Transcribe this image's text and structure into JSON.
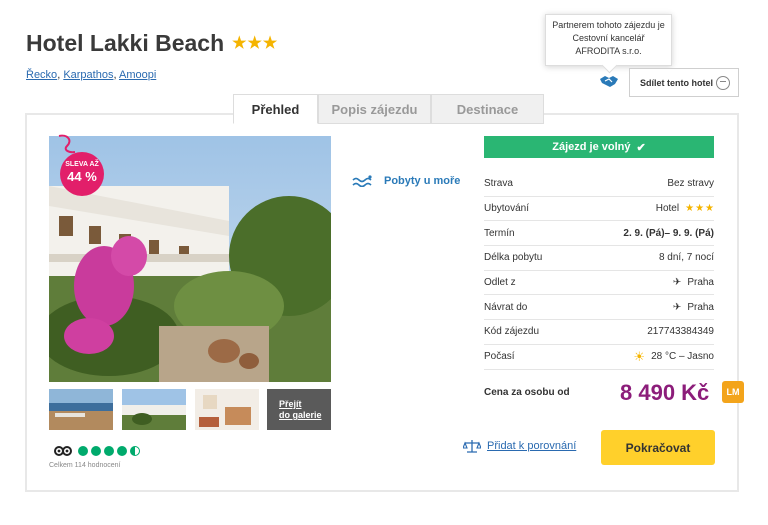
{
  "hotel": {
    "name": "Hotel Lakki Beach",
    "stars": 3
  },
  "breadcrumb": [
    "Řecko",
    "Karpathos",
    "Amoopi"
  ],
  "partner_tooltip": "Partnerem tohoto zájezdu je Cestovní kancelář AFRODITA s.r.o.",
  "share_button": "Sdílet tento hotel",
  "tabs": [
    {
      "label": "Přehled",
      "active": true
    },
    {
      "label": "Popis zájezdu",
      "active": false
    },
    {
      "label": "Destinace",
      "active": false
    }
  ],
  "sale_badge": {
    "line1": "SLEVA AŽ",
    "line2": "44 %"
  },
  "gallery_link": {
    "line1": "Přejít",
    "line2": "do galerie"
  },
  "rating": {
    "dots_filled": 4.5,
    "reviews": "Celkem 114 hodnocení"
  },
  "beach_stay": "Pobyty u moře",
  "status": "Zájezd je volný",
  "details": [
    {
      "label": "Strava",
      "value": "Bez stravy"
    },
    {
      "label": "Ubytování",
      "value": "Hotel"
    },
    {
      "label": "Termín",
      "value": "2. 9. (Pá)– 9. 9. (Pá)"
    },
    {
      "label": "Délka pobytu",
      "value": "8 dní, 7 nocí"
    },
    {
      "label": "Odlet z",
      "value": "Praha"
    },
    {
      "label": "Návrat do",
      "value": "Praha"
    },
    {
      "label": "Kód zájezdu",
      "value": "217743384349"
    },
    {
      "label": "Počasí",
      "value": "28 °C – Jasno"
    }
  ],
  "price": {
    "label": "Cena za osobu od",
    "value": "8 490 Kč",
    "badge": "LM"
  },
  "compare_link": "Přidat k porovnání",
  "continue_button": "Pokračovat",
  "colors": {
    "accent_green": "#2ab673",
    "price_purple": "#8c1d7a",
    "button_yellow": "#ffd02b",
    "sale_pink": "#e21f6a",
    "lm_orange": "#f3a41b"
  }
}
